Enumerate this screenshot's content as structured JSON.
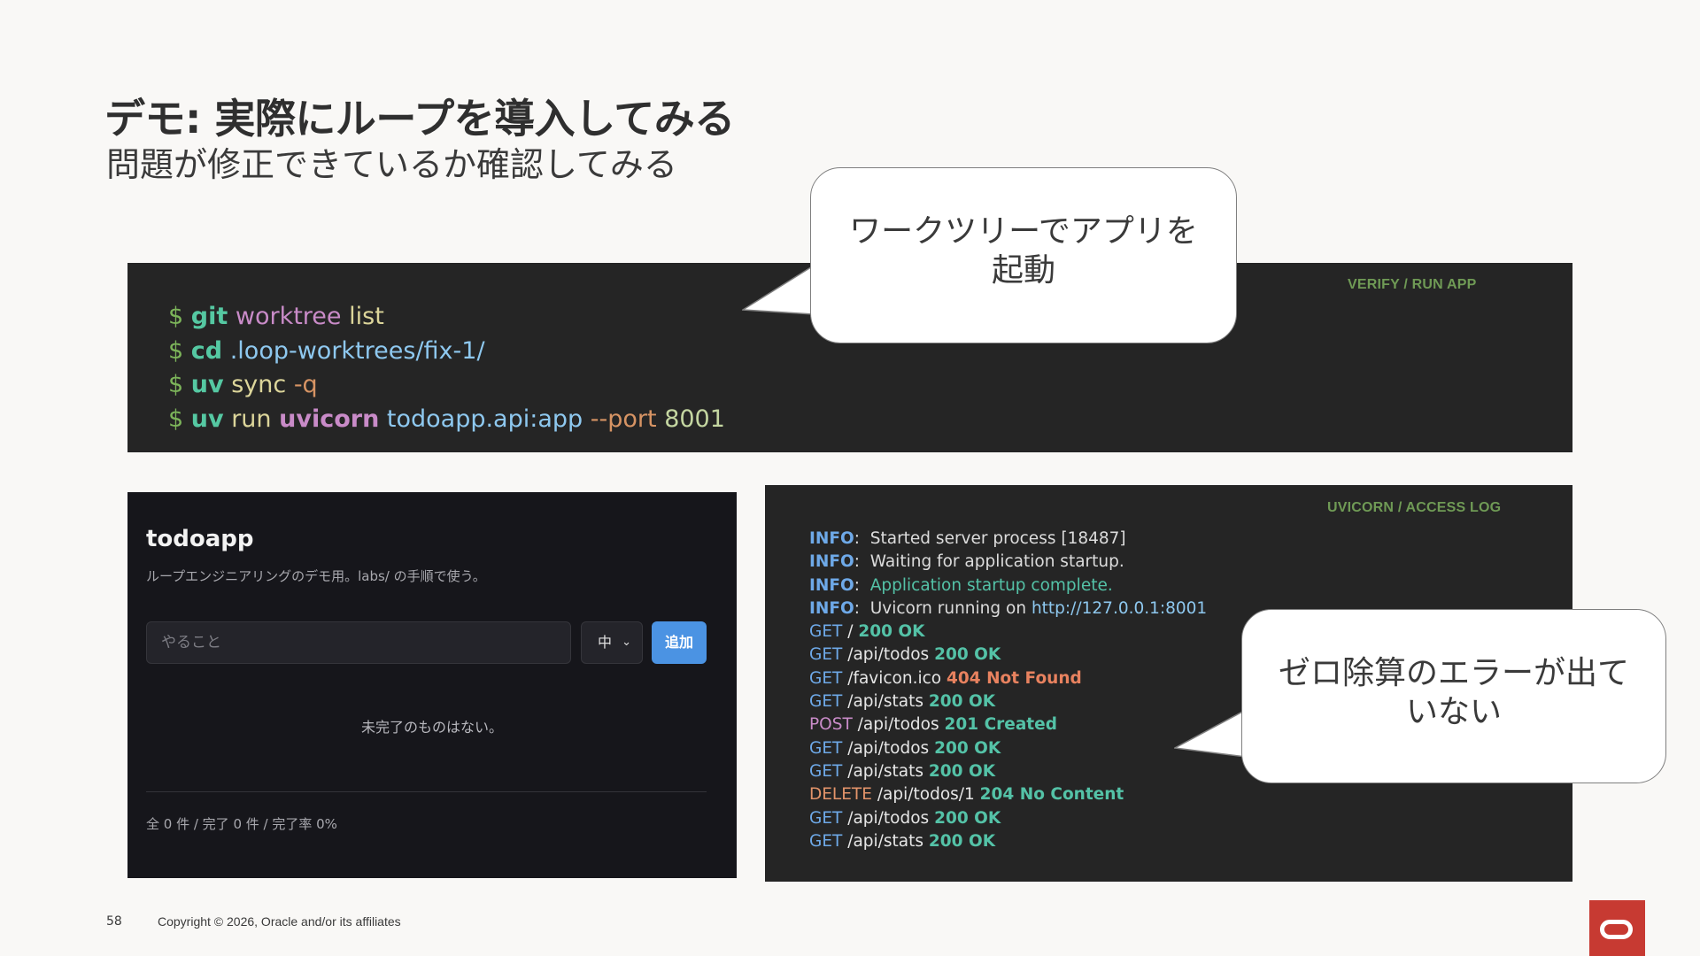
{
  "slide": {
    "title": "デモ: 実際にループを導入してみる",
    "subtitle": "問題が修正できているか確認してみる",
    "page_number": "58",
    "copyright": "Copyright © 2026, Oracle and/or its affiliates"
  },
  "terminal": {
    "tag": "VERIFY / RUN APP",
    "lines": [
      {
        "prompt": "$",
        "t1": "git",
        "t2": "worktree",
        "t3": "list",
        "t4": ""
      },
      {
        "prompt": "$",
        "t1": "cd",
        "t2": ".loop-worktrees/fix-1/",
        "t3": "",
        "t4": ""
      },
      {
        "prompt": "$",
        "t1": "uv",
        "t2": "sync",
        "t3": "-q",
        "t4": ""
      },
      {
        "prompt": "$",
        "t1": "uv",
        "t2": "run",
        "t3": "uvicorn",
        "t4": "todoapp.api:app",
        "t5": "--port",
        "t6": "8001"
      }
    ]
  },
  "callouts": {
    "worktree": "ワークツリーでアプリを起動",
    "worktree_line1": "ワークツリーでアプリを",
    "worktree_line2": "起動",
    "no_error_line1": "ゼロ除算のエラーが出て",
    "no_error_line2": "いない"
  },
  "app": {
    "name": "todoapp",
    "description": "ループエンジニアリングのデモ用。labs/ の手順で使う。",
    "input_placeholder": "やること",
    "priority_selected": "中",
    "add_button": "追加",
    "empty_message": "未完了のものはない。",
    "stats": "全 0 件 / 完了 0 件 / 完了率 0%"
  },
  "log": {
    "tag": "UVICORN / ACCESS LOG",
    "info": [
      {
        "level": "INFO",
        "sep": ":",
        "text": "Started server process [18487]",
        "extra": ""
      },
      {
        "level": "INFO",
        "sep": ":",
        "text": "Waiting for application startup.",
        "extra": ""
      },
      {
        "level": "INFO",
        "sep": ":",
        "text": "Application startup complete.",
        "extra": ""
      },
      {
        "level": "INFO",
        "sep": ":",
        "text": "Uvicorn running on",
        "extra": "http://127.0.0.1:8001"
      }
    ],
    "requests": [
      {
        "method": "GET",
        "path": "/",
        "status": "200 OK",
        "kind": "ok"
      },
      {
        "method": "GET",
        "path": "/api/todos",
        "status": "200 OK",
        "kind": "ok"
      },
      {
        "method": "GET",
        "path": "/favicon.ico",
        "status": "404 Not Found",
        "kind": "err"
      },
      {
        "method": "GET",
        "path": "/api/stats",
        "status": "200 OK",
        "kind": "ok"
      },
      {
        "method": "POST",
        "path": "/api/todos",
        "status": "201 Created",
        "kind": "ok"
      },
      {
        "method": "GET",
        "path": "/api/todos",
        "status": "200 OK",
        "kind": "ok"
      },
      {
        "method": "GET",
        "path": "/api/stats",
        "status": "200 OK",
        "kind": "ok"
      },
      {
        "method": "DELETE",
        "path": "/api/todos/1",
        "status": "204 No Content",
        "kind": "ok"
      },
      {
        "method": "GET",
        "path": "/api/todos",
        "status": "200 OK",
        "kind": "ok"
      },
      {
        "method": "GET",
        "path": "/api/stats",
        "status": "200 OK",
        "kind": "ok"
      }
    ]
  },
  "brand": {
    "logo_color": "#c73a32",
    "icon": "oracle-logo-icon"
  }
}
